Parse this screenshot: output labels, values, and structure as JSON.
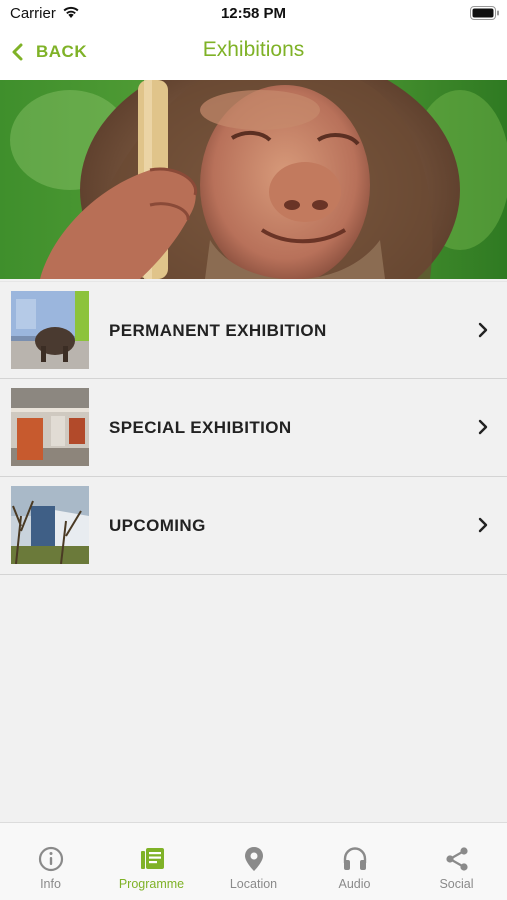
{
  "status_bar": {
    "carrier": "Carrier",
    "time": "12:58 PM"
  },
  "nav": {
    "back_label": "BACK",
    "title": "Exhibitions"
  },
  "colors": {
    "accent": "#7fb227",
    "inactive": "#8a8a8a"
  },
  "list": {
    "items": [
      {
        "label": "PERMANENT EXHIBITION"
      },
      {
        "label": "SPECIAL EXHIBITION"
      },
      {
        "label": "UPCOMING"
      }
    ]
  },
  "tab_bar": {
    "tabs": [
      {
        "label": "Info",
        "icon": "info-icon",
        "active": false
      },
      {
        "label": "Programme",
        "icon": "programme-icon",
        "active": true
      },
      {
        "label": "Location",
        "icon": "location-pin-icon",
        "active": false
      },
      {
        "label": "Audio",
        "icon": "headphones-icon",
        "active": false
      },
      {
        "label": "Social",
        "icon": "share-icon",
        "active": false
      }
    ]
  }
}
